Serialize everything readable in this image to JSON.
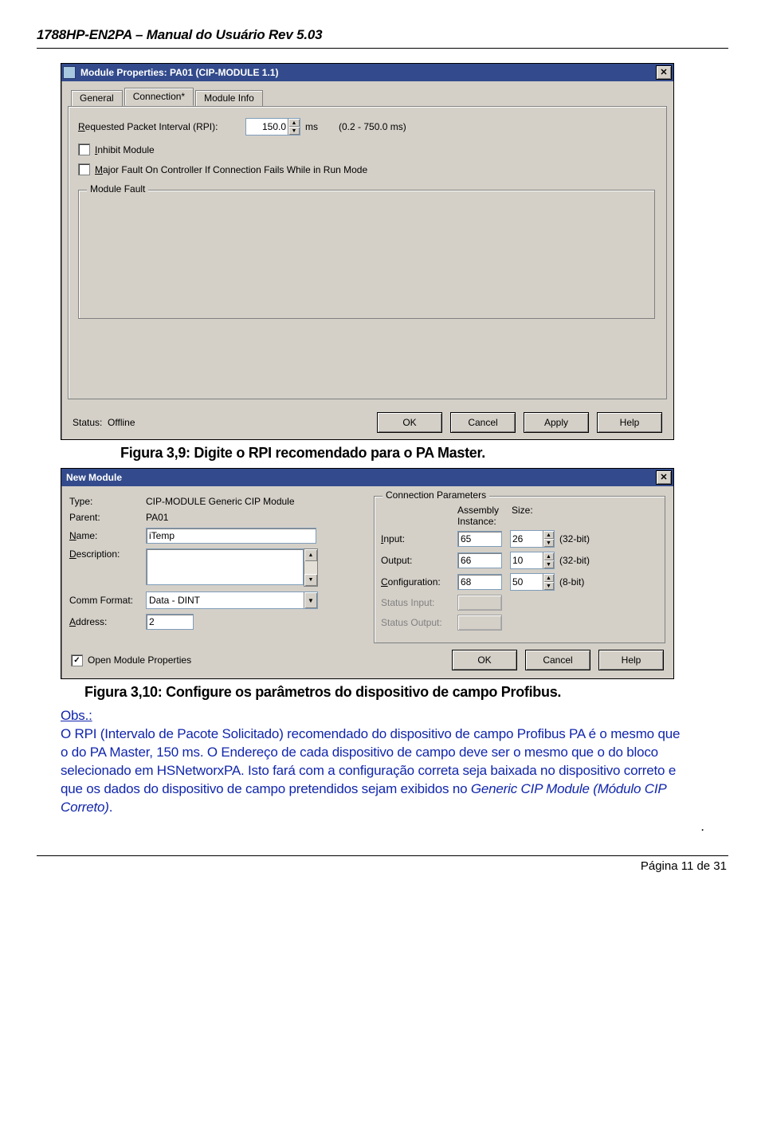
{
  "doc": {
    "header": "1788HP-EN2PA – Manual do Usuário Rev 5.03",
    "footer": "Página 11 de 31"
  },
  "win1": {
    "title": "Module Properties: PA01 (CIP-MODULE 1.1)",
    "tabs": {
      "general": "General",
      "connection": "Connection*",
      "module_info": "Module Info"
    },
    "rpi_label": "Requested Packet Interval (RPI):",
    "rpi_value": "150.0",
    "rpi_unit": "ms",
    "rpi_range": "(0.2 - 750.0 ms)",
    "inhibit_label": "Inhibit Module",
    "major_fault_label": "Major Fault On Controller If Connection Fails While in Run Mode",
    "module_fault_legend": "Module Fault",
    "status_label": "Status:",
    "status_value": "Offline",
    "buttons": {
      "ok": "OK",
      "cancel": "Cancel",
      "apply": "Apply",
      "help": "Help"
    }
  },
  "caption1": "Figura 3,9: Digite o RPI recomendado para o PA Master.",
  "win2": {
    "title": "New Module",
    "labels": {
      "type": "Type:",
      "parent": "Parent:",
      "name": "Name:",
      "desc": "Description:",
      "comm": "Comm Format:",
      "addr": "Address:"
    },
    "type_value": "CIP-MODULE Generic CIP Module",
    "parent_value": "PA01",
    "name_value": "iTemp",
    "desc_value": "",
    "comm_value": "Data - DINT",
    "addr_value": "2",
    "cp_legend": "Connection Parameters",
    "cp_headers": {
      "asm": "Assembly\nInstance:",
      "size": "Size:"
    },
    "cp": {
      "input_label": "Input:",
      "input_inst": "65",
      "input_size": "26",
      "input_unit": "(32-bit)",
      "output_label": "Output:",
      "output_inst": "66",
      "output_size": "10",
      "output_unit": "(32-bit)",
      "config_label": "Configuration:",
      "config_inst": "68",
      "config_size": "50",
      "config_unit": "(8-bit)",
      "status_in_label": "Status Input:",
      "status_out_label": "Status Output:"
    },
    "open_props": "Open Module Properties",
    "buttons": {
      "ok": "OK",
      "cancel": "Cancel",
      "help": "Help"
    }
  },
  "caption2": "Figura 3,10: Configure os parâmetros do dispositivo de campo Profibus.",
  "obs": {
    "label": "Obs.:",
    "text1": "O RPI (Intervalo de Pacote Solicitado) recomendado do dispositivo de campo Profibus PA é o mesmo que o do PA Master, 150 ms. O Endereço de cada dispositivo de campo deve ser o mesmo que o do bloco selecionado em HSNetworxPA. Isto fará com a configuração correta seja baixada no dispositivo correto e que os dados do dispositivo de campo pretendidos sejam exibidos no ",
    "italic": "Generic CIP Module (Módulo CIP Correto)",
    "trail": "."
  }
}
